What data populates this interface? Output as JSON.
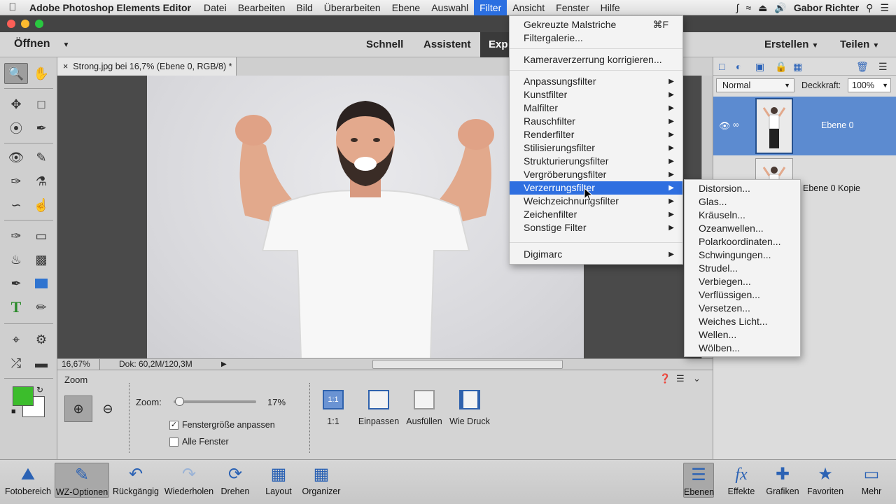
{
  "os_menu": {
    "app_name": "Adobe Photoshop Elements Editor",
    "items": [
      "Datei",
      "Bearbeiten",
      "Bild",
      "Überarbeiten",
      "Ebene",
      "Auswahl",
      "Filter",
      "Ansicht",
      "Fenster",
      "Hilfe"
    ],
    "active_item": "Filter",
    "user": "Gabor Richter"
  },
  "appbar": {
    "open_label": "Öffnen",
    "modes": [
      "Schnell",
      "Assistent",
      "Exp"
    ],
    "active_mode": "Exp",
    "create_label": "Erstellen",
    "share_label": "Teilen"
  },
  "document": {
    "tab_title": "Strong.jpg bei 16,7% (Ebene 0, RGB/8) *",
    "close_glyph": "×",
    "zoom": "16,67%",
    "doc_size": "Dok: 60,2M/120,3M"
  },
  "colors": {
    "foreground": "#3cbd2c",
    "background": "#ffffff",
    "menu_highlight": "#2f6fe0",
    "layer_selected": "#5c8bd0"
  },
  "layers": {
    "blend_mode": "Normal",
    "opacity_label": "Deckkraft:",
    "opacity_value": "100%",
    "items": [
      {
        "name": "Ebene 0"
      },
      {
        "name": "Ebene 0 Kopie"
      }
    ]
  },
  "tool_options": {
    "title": "Zoom",
    "zoom_label": "Zoom:",
    "zoom_percent": "17%",
    "zoom_slider_fraction": 0.03,
    "checkbox_fit": {
      "label": "Fenstergröße anpassen",
      "checked": true
    },
    "checkbox_all": {
      "label": "Alle Fenster",
      "checked": false
    },
    "view_buttons": [
      "1:1",
      "Einpassen",
      "Ausfüllen",
      "Wie Druck"
    ],
    "one_to_one_icon_text": "1:1"
  },
  "taskbar": {
    "left": [
      "Fotobereich",
      "WZ-Optionen",
      "Rückgängig",
      "Wiederholen",
      "Drehen",
      "Layout",
      "Organizer"
    ],
    "right": [
      "Ebenen",
      "Effekte",
      "Grafiken",
      "Favoriten",
      "Mehr"
    ],
    "fx_text": "fx"
  },
  "filter_menu": {
    "top_items": [
      {
        "label": "Gekreuzte Malstriche",
        "shortcut": "⌘F"
      },
      {
        "label": "Filtergalerie..."
      }
    ],
    "correction_item": "Kameraverzerrung korrigieren...",
    "submenu_items": [
      "Anpassungsfilter",
      "Kunstfilter",
      "Malfilter",
      "Rauschfilter",
      "Renderfilter",
      "Stilisierungsfilter",
      "Strukturierungsfilter",
      "Vergröberungsfilter",
      "Verzerrungsfilter",
      "Weichzeichnungsfilter",
      "Zeichenfilter",
      "Sonstige Filter"
    ],
    "highlighted": "Verzerrungsfilter",
    "digimarc": "Digimarc"
  },
  "distort_submenu": {
    "items": [
      "Distorsion...",
      "Glas...",
      "Kräuseln...",
      "Ozeanwellen...",
      "Polarkoordinaten...",
      "Schwingungen...",
      "Strudel...",
      "Verbiegen...",
      "Verflüssigen...",
      "Versetzen...",
      "Weiches Licht...",
      "Wellen...",
      "Wölben..."
    ]
  }
}
